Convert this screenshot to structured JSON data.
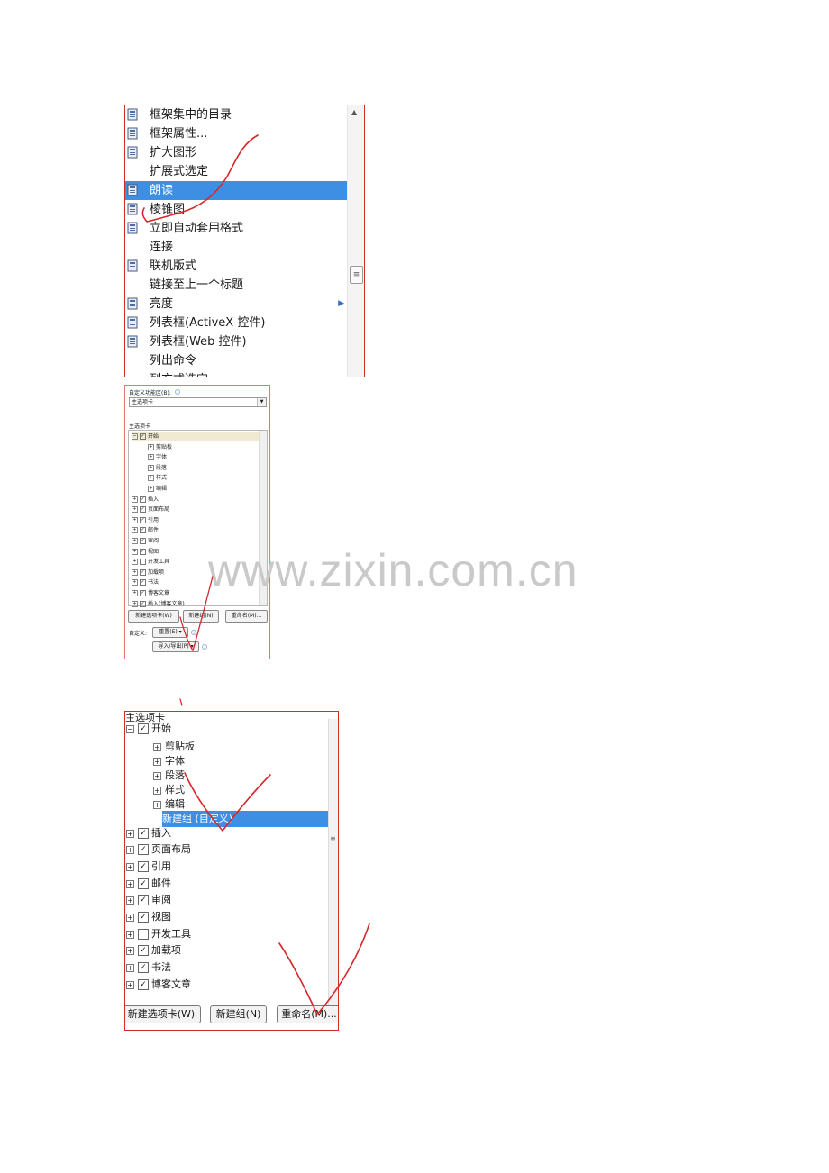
{
  "shot1": {
    "items": [
      {
        "label": "框架集中的目录",
        "icon": "frame-toc-icon"
      },
      {
        "label": "框架属性...",
        "icon": "frame-properties-icon"
      },
      {
        "label": "扩大图形",
        "icon": "enlarge-shape-icon"
      },
      {
        "label": "扩展式选定",
        "icon": ""
      },
      {
        "label": "朗读",
        "icon": "speak-icon",
        "selected": true
      },
      {
        "label": "棱锥图",
        "icon": "pyramid-chart-icon"
      },
      {
        "label": "立即自动套用格式",
        "icon": "autoformat-icon"
      },
      {
        "label": "连接",
        "icon": ""
      },
      {
        "label": "联机版式",
        "icon": "web-layout-icon"
      },
      {
        "label": "链接至上一个标题",
        "icon": ""
      },
      {
        "label": "亮度",
        "icon": "brightness-icon",
        "submenu": true
      },
      {
        "label": "列表框(ActiveX 控件)",
        "icon": "listbox-icon"
      },
      {
        "label": "列表框(Web 控件)",
        "icon": "listbox-icon"
      },
      {
        "label": "列出命令",
        "icon": ""
      },
      {
        "label": "列方式选定",
        "icon": ""
      }
    ]
  },
  "shot2": {
    "customize_label": "自定义功能区(B):",
    "combo_value": "主选项卡",
    "tree_header": "主选项卡",
    "tree": [
      {
        "label": "开始",
        "level": 0,
        "checked": true,
        "expanded": true,
        "highlight": true
      },
      {
        "label": "剪贴板",
        "level": 1
      },
      {
        "label": "字体",
        "level": 1
      },
      {
        "label": "段落",
        "level": 1
      },
      {
        "label": "样式",
        "level": 1
      },
      {
        "label": "编辑",
        "level": 1
      },
      {
        "label": "插入",
        "level": 0,
        "checked": true
      },
      {
        "label": "页面布局",
        "level": 0,
        "checked": true
      },
      {
        "label": "引用",
        "level": 0,
        "checked": true
      },
      {
        "label": "邮件",
        "level": 0,
        "checked": true
      },
      {
        "label": "审阅",
        "level": 0,
        "checked": true
      },
      {
        "label": "视图",
        "level": 0,
        "checked": true
      },
      {
        "label": "开发工具",
        "level": 0,
        "checked": false
      },
      {
        "label": "加载项",
        "level": 0,
        "checked": true
      },
      {
        "label": "书法",
        "level": 0,
        "checked": true
      },
      {
        "label": "博客文章",
        "level": 0,
        "checked": true
      },
      {
        "label": "插入(博客文章)",
        "level": 0,
        "checked": true
      }
    ],
    "new_tab_button": "新建选项卡(W)",
    "new_group_button": "新建组(N)",
    "rename_button": "重命名(M)...",
    "custom_label": "自定义:",
    "reset_button": "重置(E) ▾",
    "import_export_button": "导入/导出(P) ▾"
  },
  "shot3": {
    "header": "主选项卡",
    "tree": [
      {
        "label": "开始",
        "level": 0,
        "checked": true,
        "expanded": true
      },
      {
        "label": "剪贴板",
        "level": 1
      },
      {
        "label": "字体",
        "level": 1
      },
      {
        "label": "段落",
        "level": 1
      },
      {
        "label": "样式",
        "level": 1
      },
      {
        "label": "编辑",
        "level": 1
      },
      {
        "label": "新建组 (自定义)",
        "level": 2,
        "selected": true
      },
      {
        "label": "插入",
        "level": 0,
        "checked": true
      },
      {
        "label": "页面布局",
        "level": 0,
        "checked": true
      },
      {
        "label": "引用",
        "level": 0,
        "checked": true
      },
      {
        "label": "邮件",
        "level": 0,
        "checked": true
      },
      {
        "label": "审阅",
        "level": 0,
        "checked": true
      },
      {
        "label": "视图",
        "level": 0,
        "checked": true
      },
      {
        "label": "开发工具",
        "level": 0,
        "checked": false
      },
      {
        "label": "加载项",
        "level": 0,
        "checked": true
      },
      {
        "label": "书法",
        "level": 0,
        "checked": true
      },
      {
        "label": "博客文章",
        "level": 0,
        "checked": true
      }
    ],
    "new_tab_button": "新建选项卡(W)",
    "new_group_button": "新建组(N)",
    "rename_button": "重命名(M)..."
  },
  "watermark": "www.zixin.com.cn",
  "colors": {
    "selection": "#3d8fe3",
    "frame_border": "#d42a2a",
    "annotation": "#d8262b"
  }
}
